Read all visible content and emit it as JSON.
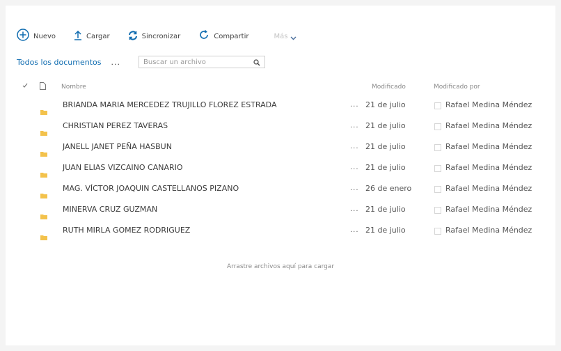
{
  "toolbar": {
    "new_label": "Nuevo",
    "upload_label": "Cargar",
    "sync_label": "Sincronizar",
    "share_label": "Compartir",
    "more_label": "Más"
  },
  "breadcrumb": {
    "all_docs": "Todos los documentos",
    "more": "..."
  },
  "search": {
    "placeholder": "Buscar un archivo"
  },
  "columns": {
    "name": "Nombre",
    "modified": "Modificado",
    "modified_by": "Modificado por"
  },
  "rows": [
    {
      "name": "BRIANDA MARIA MERCEDEZ TRUJILLO FLOREZ ESTRADA",
      "ellipsis": "...",
      "modified": "21 de julio",
      "modified_by": "Rafael Medina Méndez"
    },
    {
      "name": "CHRISTIAN PEREZ TAVERAS",
      "ellipsis": "...",
      "modified": "21 de julio",
      "modified_by": "Rafael Medina Méndez"
    },
    {
      "name": "JANELL JANET PEÑA HASBUN",
      "ellipsis": "...",
      "modified": "21 de julio",
      "modified_by": "Rafael Medina Méndez"
    },
    {
      "name": "JUAN ELIAS VIZCAINO CANARIO",
      "ellipsis": "...",
      "modified": "21 de julio",
      "modified_by": "Rafael Medina Méndez"
    },
    {
      "name": "MAG. VÍCTOR JOAQUIN CASTELLANOS PIZANO",
      "ellipsis": "...",
      "modified": "26 de enero",
      "modified_by": "Rafael Medina Méndez"
    },
    {
      "name": "MINERVA CRUZ GUZMAN",
      "ellipsis": "...",
      "modified": "21 de julio",
      "modified_by": "Rafael Medina Méndez"
    },
    {
      "name": "RUTH MIRLA GOMEZ RODRIGUEZ",
      "ellipsis": "...",
      "modified": "21 de julio",
      "modified_by": "Rafael Medina Méndez"
    }
  ],
  "drop_hint": "Arrastre archivos aquí para cargar",
  "colors": {
    "accent": "#0f6cb0",
    "folder": "#f3c24c",
    "disabled": "#c4c4c4"
  },
  "icons": {
    "new": "plus-circle-icon",
    "upload": "upload-arrow-icon",
    "sync": "sync-icon",
    "share": "share-icon",
    "more": "chevron-down-icon",
    "search": "search-icon",
    "select_all": "check-icon",
    "file_type": "document-icon",
    "row": "folder-icon"
  }
}
